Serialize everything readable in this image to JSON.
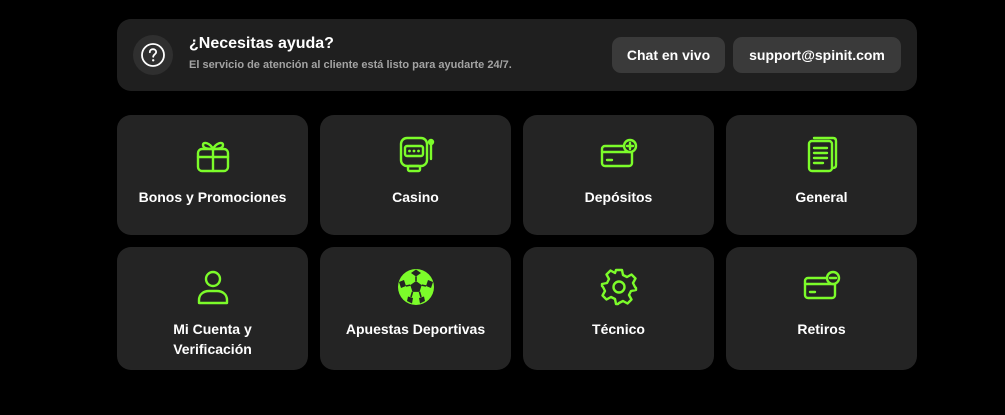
{
  "colors": {
    "accent": "#7cfc2a",
    "banner_bg": "#1f1f1f",
    "tile_bg": "#242424",
    "pill_bg": "#3a3a3a"
  },
  "help": {
    "icon": "question-circle-icon",
    "title": "¿Necesitas ayuda?",
    "subtitle": "El servicio de atención al cliente está listo para ayudarte 24/7.",
    "chat_label": "Chat en vivo",
    "email_label": "support@spinit.com"
  },
  "categories": [
    {
      "label": "Bonos y Promociones",
      "icon": "gift-icon"
    },
    {
      "label": "Casino",
      "icon": "slot-machine-icon"
    },
    {
      "label": "Depósitos",
      "icon": "card-plus-icon"
    },
    {
      "label": "General",
      "icon": "document-icon"
    },
    {
      "label": "Mi Cuenta y Verificación",
      "icon": "user-icon"
    },
    {
      "label": "Apuestas Deportivas",
      "icon": "soccer-ball-icon"
    },
    {
      "label": "Técnico",
      "icon": "gear-icon"
    },
    {
      "label": "Retiros",
      "icon": "card-minus-icon"
    }
  ]
}
